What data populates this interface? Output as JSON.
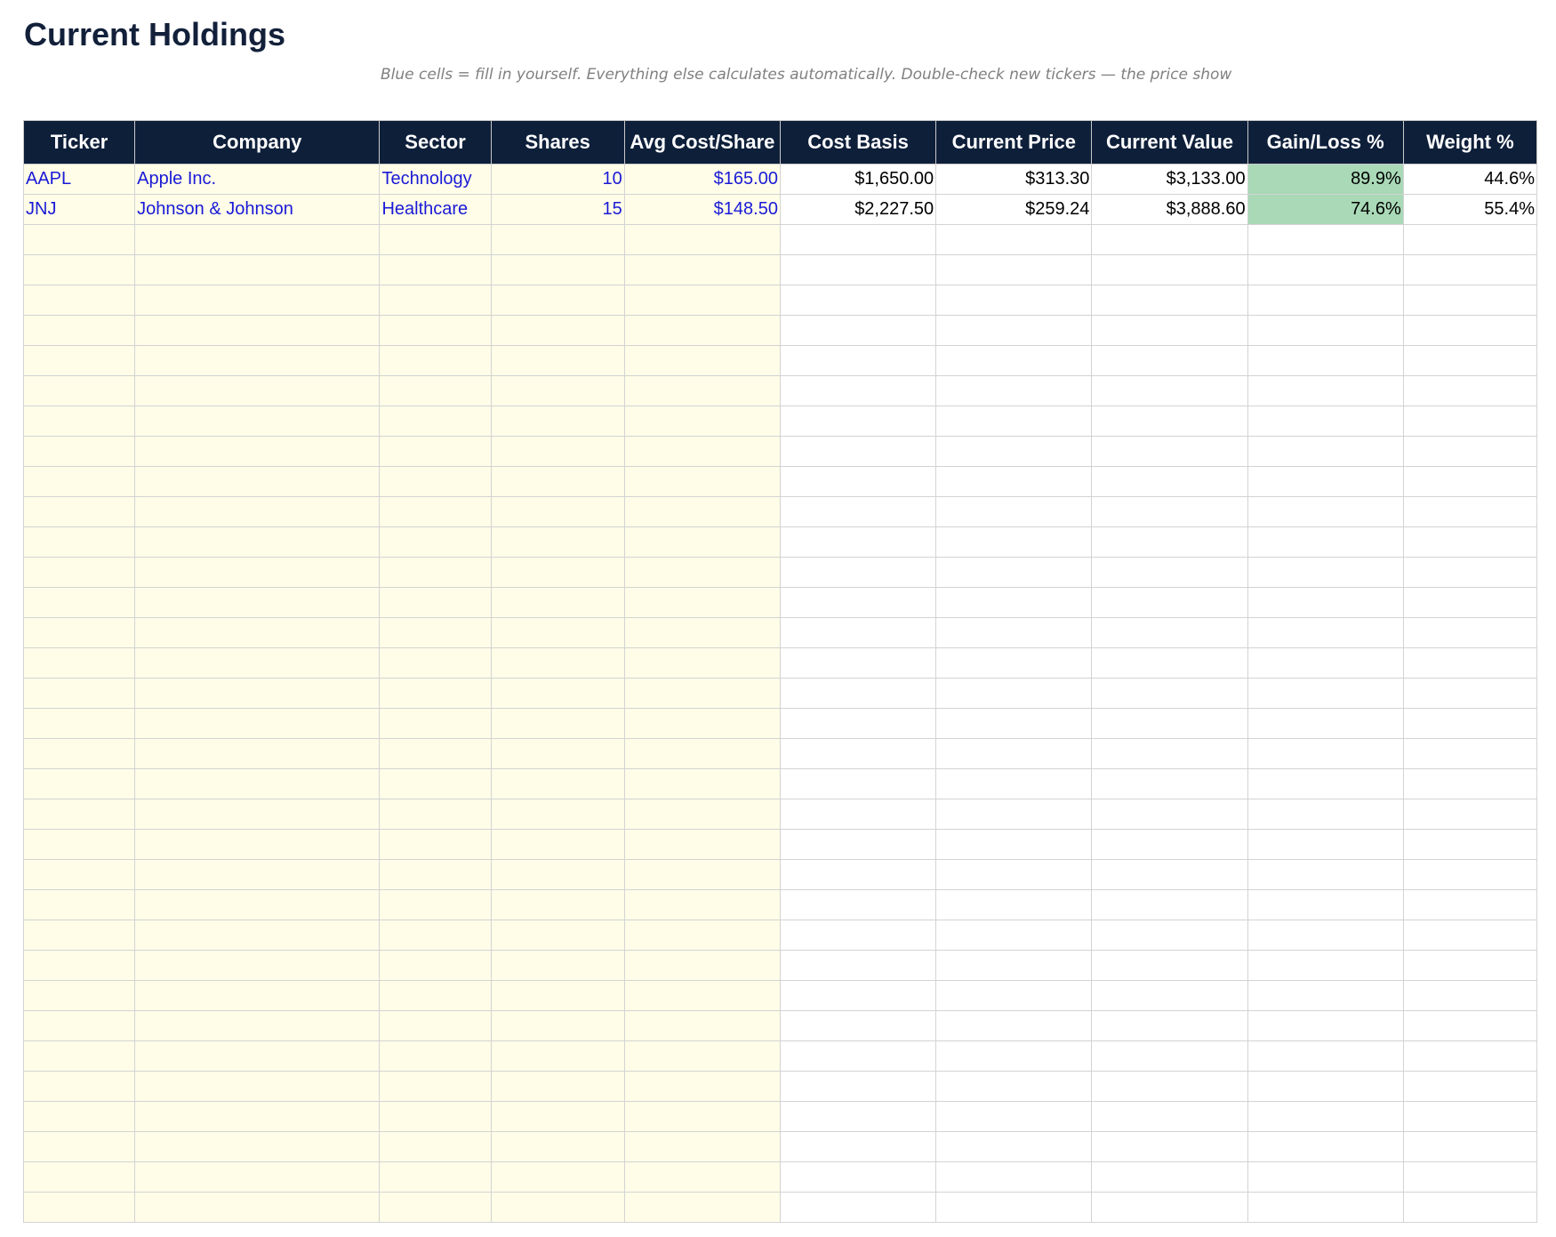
{
  "page": {
    "title": "Current Holdings",
    "subtitle": "Blue cells = fill in yourself. Everything else calculates automatically. Double-check new tickers — the price shown is w"
  },
  "colors": {
    "header_bg": "#0e1f3a",
    "header_text": "#ffffff",
    "input_bg": "#fffde8",
    "input_text": "#1a1ad6",
    "gain_positive_bg": "#a9d9b7",
    "grid": "#d3d3d3"
  },
  "table": {
    "headers": [
      "Ticker",
      "Company",
      "Sector",
      "Shares",
      "Avg Cost/Share",
      "Cost Basis",
      "Current Price",
      "Current Value",
      "Gain/Loss %",
      "Weight %"
    ],
    "rows": [
      {
        "ticker": "AAPL",
        "company": "Apple Inc.",
        "sector": "Technology",
        "shares": "10",
        "avg_cost": "$165.00",
        "cost_basis": "$1,650.00",
        "current_price": "$313.30",
        "current_value": "$3,133.00",
        "gain_loss": "89.9%",
        "weight": "44.6%"
      },
      {
        "ticker": "JNJ",
        "company": "Johnson & Johnson",
        "sector": "Healthcare",
        "shares": "15",
        "avg_cost": "$148.50",
        "cost_basis": "$2,227.50",
        "current_price": "$259.24",
        "current_value": "$3,888.60",
        "gain_loss": "74.6%",
        "weight": "55.4%"
      }
    ],
    "empty_row_count": 33
  }
}
